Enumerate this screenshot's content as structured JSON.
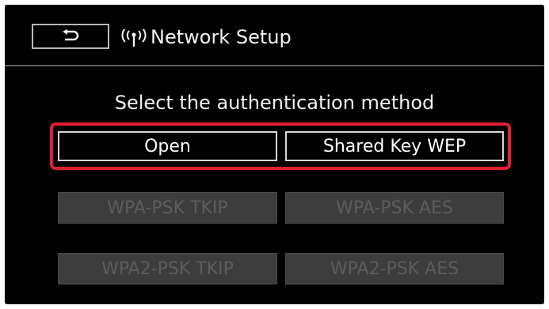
{
  "header": {
    "back_icon": "return-arrow-icon",
    "network_icon": "wireless-signal-icon",
    "title": "Network Setup"
  },
  "prompt": "Select the authentication method",
  "options": [
    {
      "label": "Open",
      "enabled": true
    },
    {
      "label": "Shared Key WEP",
      "enabled": true
    },
    {
      "label": "WPA-PSK TKIP",
      "enabled": false
    },
    {
      "label": "WPA-PSK AES",
      "enabled": false
    },
    {
      "label": "WPA2-PSK TKIP",
      "enabled": false
    },
    {
      "label": "WPA2-PSK AES",
      "enabled": false
    }
  ],
  "colors": {
    "highlight": "#e02030",
    "background": "#000000",
    "disabled_button": "#3d3d3d",
    "disabled_text": "#5d5d5d"
  }
}
